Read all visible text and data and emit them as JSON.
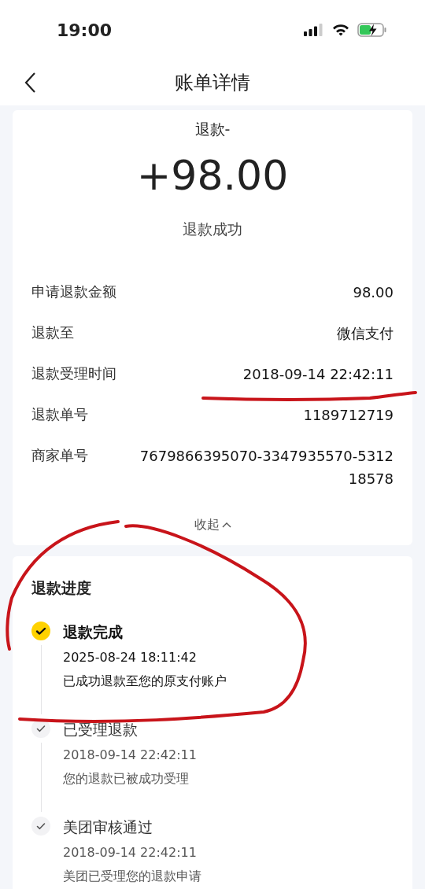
{
  "status_bar": {
    "time": "19:00"
  },
  "nav": {
    "title": "账单详情"
  },
  "summary": {
    "type_label": "退款-",
    "amount": "+98.00",
    "status": "退款成功"
  },
  "details": [
    {
      "label": "申请退款金额",
      "value": "98.00"
    },
    {
      "label": "退款至",
      "value": "微信支付"
    },
    {
      "label": "退款受理时间",
      "value": "2018-09-14 22:42:11"
    },
    {
      "label": "退款单号",
      "value": "1189712719"
    },
    {
      "label": "商家单号",
      "value": "7679866395070-3347935570-531218578"
    }
  ],
  "collapse_link": "收起",
  "progress": {
    "title": "退款进度",
    "steps": [
      {
        "title": "退款完成",
        "time": "2025-08-24 18:11:42",
        "desc": "已成功退款至您的原支付账户",
        "current": true
      },
      {
        "title": "已受理退款",
        "time": "2018-09-14 22:42:11",
        "desc": "您的退款已被成功受理",
        "current": false
      },
      {
        "title": "美团审核通过",
        "time": "2018-09-14 22:42:11",
        "desc": "美团已受理您的退款申请",
        "current": false
      }
    ]
  }
}
